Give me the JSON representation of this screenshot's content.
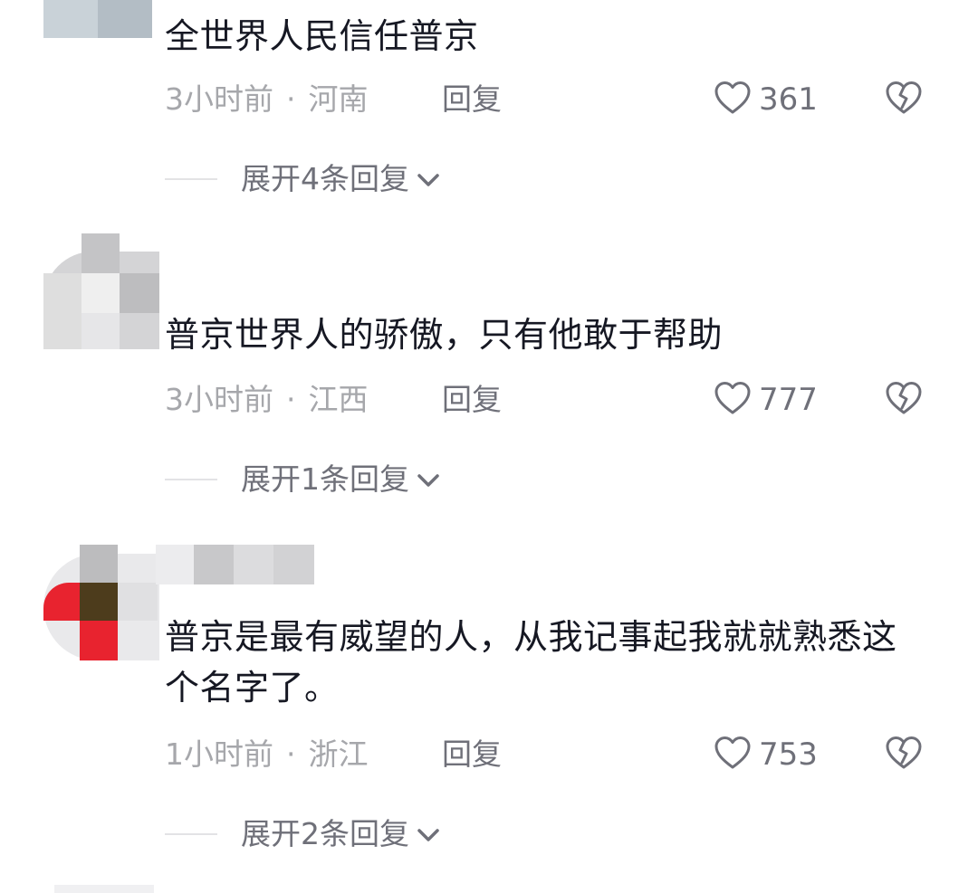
{
  "comments": [
    {
      "text": "全世界人民信任普京",
      "time": "3小时前",
      "separator": "·",
      "location": "河南",
      "reply_label": "回复",
      "likes": "361",
      "expand_label": "展开4条回复"
    },
    {
      "text": "普京世界人的骄傲，只有他敢于帮助",
      "time": "3小时前",
      "separator": "·",
      "location": "江西",
      "reply_label": "回复",
      "likes": "777",
      "expand_label": "展开1条回复"
    },
    {
      "text": "普京是最有威望的人，从我记事起我就就熟悉这个名字了。",
      "time": "1小时前",
      "separator": "·",
      "location": "浙江",
      "reply_label": "回复",
      "likes": "753",
      "expand_label": "展开2条回复"
    }
  ],
  "icons": {
    "like": "heart-outline-icon",
    "dislike": "broken-heart-icon",
    "expand": "chevron-down-icon"
  },
  "colors": {
    "text": "#161823",
    "meta": "#a6a7ab",
    "action": "#6f7079",
    "divider": "#e3e3e5"
  }
}
